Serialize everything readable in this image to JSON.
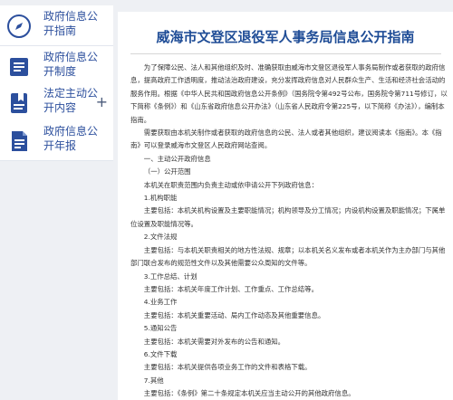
{
  "sidebar": {
    "items": [
      {
        "label": "政府信息公开指南",
        "icon": "compass-icon"
      },
      {
        "label": "政府信息公开制度",
        "icon": "document-list-icon"
      },
      {
        "label": "法定主动公开内容",
        "icon": "bookmark-doc-icon",
        "expand": "+"
      },
      {
        "label": "政府信息公开年报",
        "icon": "report-doc-icon"
      }
    ]
  },
  "main": {
    "title": "威海市文登区退役军人事务局信息公开指南",
    "paragraphs": [
      "为了保障公民、法人和其他组织及时、准确获取由威海市文登区退役军人事务局制作或者获取的政府信息，提高政府工作透明度，推动法治政府建设，充分发挥政府信息对人民群众生产、生活和经济社会活动的服务作用。根据《中华人民共和国政府信息公开条例》（国务院令第492号公布，国务院令第711号修订，以下简称《条例》）和《山东省政府信息公开办法》（山东省人民政府令第225号，以下简称《办法》），编制本指南。",
      "需要获取由本机关制作或者获取的政府信息的公民、法人或者其他组织，建议阅读本《指南》。本《指南》可以登录威海市文登区人民政府网站查阅。",
      "一、主动公开政府信息",
      "（一）公开范围",
      "本机关在职责范围内负责主动或依申请公开下列政府信息：",
      "1.机构职能",
      "主要包括：本机关机构设置及主要职能情况；机构领导及分工情况；内设机构设置及职能情况；下属单位设置及职能情况等。",
      "2.文件法规",
      "主要包括：与本机关职责相关的地方性法规、规章；以本机关名义发布或者本机关作为主办部门与其他部门联合发布的规范性文件以及其他需要公众周知的文件等。",
      "3.工作总结、计划",
      "主要包括：本机关年度工作计划、工作重点、工作总结等。",
      "4.业务工作",
      "主要包括：本机关重要活动、局内工作动态及其他重要信息。",
      "5.通知公告",
      "主要包括：本机关需要对外发布的公告和通知。",
      "6.文件下载",
      "主要包括：本机关提供各项业务工作的文件和表格下载。",
      "7.其他",
      "主要包括：《条例》第二十条规定本机关应当主动公开的其他政府信息。"
    ]
  },
  "colors": {
    "accent": "#1e4c96",
    "nav_text": "#2c4f9d",
    "body_text": "#333333",
    "background": "#eef0f4"
  }
}
